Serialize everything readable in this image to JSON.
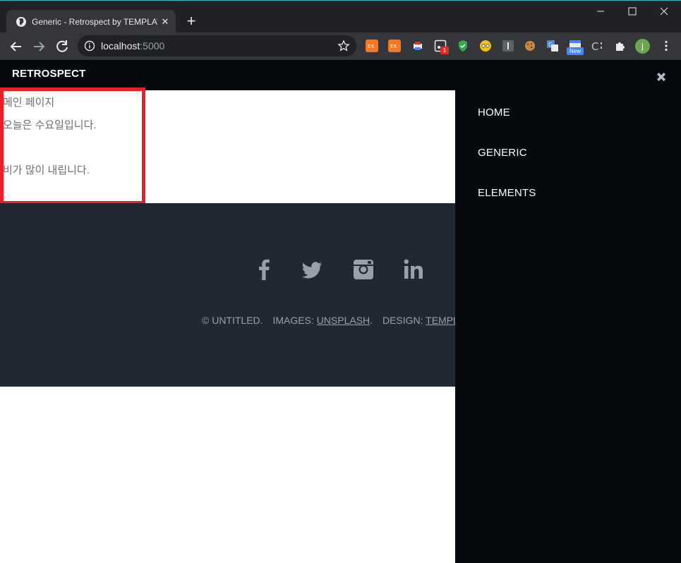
{
  "browser": {
    "tab_title": "Generic - Retrospect by TEMPLATED",
    "url_host": "localhost",
    "url_port": ":5000",
    "profile_initial": "j",
    "extension_badge_count": "1",
    "extension_new_label": "New",
    "extensions": [
      "ex-icon",
      "ex-icon",
      "printer-icon",
      "screenshot-icon",
      "shield-icon",
      "glasses-icon",
      "info-icon",
      "cookie-icon",
      "translate-icon",
      "new-extension-icon",
      "css-icon",
      "puzzle-icon"
    ]
  },
  "header": {
    "logo": "RETROSPECT"
  },
  "content": {
    "line1": "메인 페이지",
    "line2": "오늘은 수요일입니다.",
    "line3": "비가 많이 내립니다."
  },
  "footer": {
    "social_icons": [
      "facebook-icon",
      "twitter-icon",
      "instagram-icon",
      "linkedin-icon"
    ],
    "copyright": "© UNTITLED.",
    "images_label": "IMAGES:",
    "images_link": "UNSPLASH",
    "images_suffix": ".",
    "design_label": "DESIGN:",
    "design_link": "TEMPLATED"
  },
  "menu": {
    "items": [
      {
        "label": "HOME"
      },
      {
        "label": "GENERIC"
      },
      {
        "label": "ELEMENTS"
      }
    ]
  },
  "colors": {
    "header_bg": "#05080c",
    "footer_bg": "#1f2833",
    "highlight_border": "#e8202a",
    "text_gray": "#6a6f76"
  }
}
